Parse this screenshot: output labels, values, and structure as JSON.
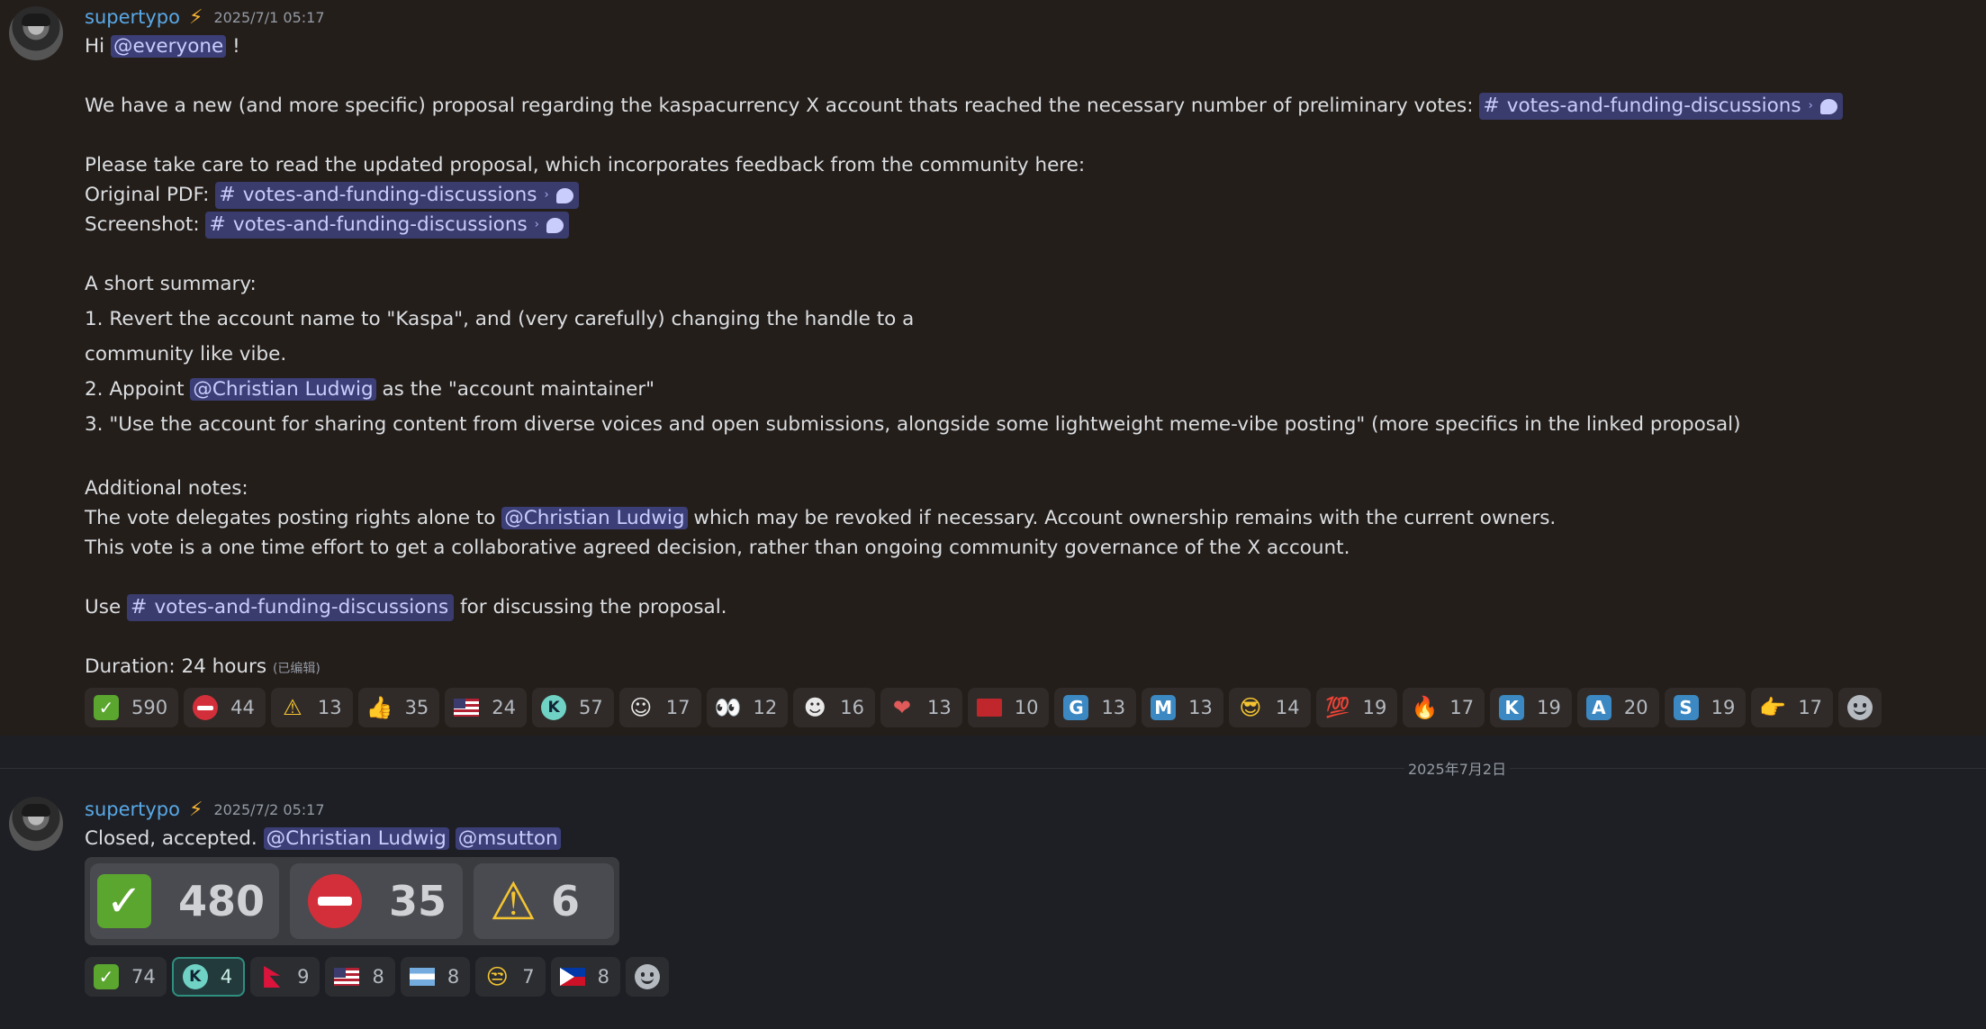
{
  "message1": {
    "username": "supertypo",
    "badge_icon": "lightning-bolt-icon",
    "timestamp": "2025/7/1 05:17",
    "greeting_pre": "Hi ",
    "greeting_mention": "@everyone",
    "greeting_post": " !",
    "proposal_text": "We have a new (and more specific) proposal regarding the kaspacurrency X account thats reached the necessary number of preliminary votes: ",
    "channel_name": "votes-and-funding-discussions",
    "read_text": "Please take care to read the updated proposal, which incorporates feedback from the community here:",
    "original_pdf_label": "Original PDF: ",
    "screenshot_label": "Screenshot: ",
    "summary_title": "A short summary:",
    "summary_1a": "1. Revert the account name to \"Kaspa\", and (very carefully) changing the handle to a",
    "summary_1b": "community like vibe.",
    "summary_2_pre": "2. Appoint ",
    "summary_2_mention": "@Christian Ludwig",
    "summary_2_post": " as the \"account maintainer\"",
    "summary_3": "3. \"Use the account for sharing content from diverse voices and open submissions, alongside some lightweight meme-vibe posting\" (more specifics in the linked proposal)",
    "notes_title": "Additional notes:",
    "notes_1_pre": "The vote delegates posting rights alone to ",
    "notes_1_mention": "@Christian Ludwig",
    "notes_1_post": " which may be revoked if necessary. Account ownership remains with the current owners.",
    "notes_2": "This vote is a one time effort to get a collaborative agreed decision, rather than ongoing community governance of the X account.",
    "use_pre": "Use ",
    "use_post": " for discussing the proposal.",
    "duration": "Duration: 24 hours ",
    "edited": "(已编辑)",
    "reactions": [
      {
        "icon": "check-mark-icon",
        "count": "590"
      },
      {
        "icon": "no-entry-icon",
        "count": "44"
      },
      {
        "icon": "warning-icon",
        "count": "13"
      },
      {
        "icon": "thumbs-up-icon",
        "count": "35"
      },
      {
        "icon": "us-flag-icon",
        "count": "24"
      },
      {
        "icon": "kaspa-icon",
        "count": "57"
      },
      {
        "icon": "person-sticker-icon",
        "count": "17"
      },
      {
        "icon": "eyes-icon",
        "count": "12"
      },
      {
        "icon": "person-sticker-2-icon",
        "count": "16"
      },
      {
        "icon": "heart-hand-icon",
        "count": "13"
      },
      {
        "icon": "red-flag-icon",
        "count": "10"
      },
      {
        "icon": "letter-g-icon",
        "count": "13",
        "letter": "G"
      },
      {
        "icon": "letter-m-icon",
        "count": "13",
        "letter": "M"
      },
      {
        "icon": "sunglasses-icon",
        "count": "14"
      },
      {
        "icon": "hundred-icon",
        "count": "19"
      },
      {
        "icon": "fire-icon",
        "count": "17"
      },
      {
        "icon": "letter-k-icon",
        "count": "19",
        "letter": "K"
      },
      {
        "icon": "letter-a-icon",
        "count": "20",
        "letter": "A"
      },
      {
        "icon": "letter-s-icon",
        "count": "19",
        "letter": "S"
      },
      {
        "icon": "hand-pointing-icon",
        "count": "17"
      }
    ]
  },
  "date_divider": "2025年7月2日",
  "message2": {
    "username": "supertypo",
    "timestamp": "2025/7/2 05:17",
    "text": "Closed, accepted. ",
    "mention_1": "@Christian Ludwig",
    "mention_2": "@msutton",
    "results": [
      {
        "icon": "check-mark-icon",
        "count": "480"
      },
      {
        "icon": "no-entry-icon",
        "count": "35"
      },
      {
        "icon": "warning-icon",
        "count": "6"
      }
    ],
    "reactions": [
      {
        "icon": "check-mark-icon",
        "count": "74"
      },
      {
        "icon": "kaspa-icon",
        "count": "4"
      },
      {
        "icon": "nepal-flag-icon",
        "count": "9"
      },
      {
        "icon": "us-flag-icon",
        "count": "8"
      },
      {
        "icon": "argentina-flag-icon",
        "count": "8"
      },
      {
        "icon": "unamused-face-icon",
        "count": "7"
      },
      {
        "icon": "philippines-flag-icon",
        "count": "8"
      }
    ]
  },
  "colors": {
    "username": "#58a8e6",
    "mention_bg": "#3c3f77",
    "check_green": "#5aa62f",
    "no_entry_red": "#d32f3a"
  }
}
